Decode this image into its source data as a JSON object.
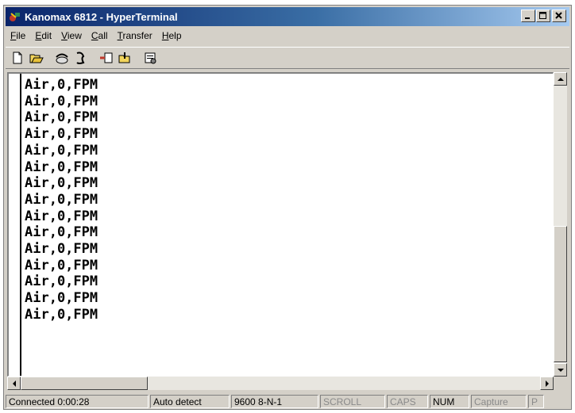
{
  "window": {
    "title": "Kanomax 6812 - HyperTerminal"
  },
  "menu": [
    {
      "key": "F",
      "rest": "ile"
    },
    {
      "key": "E",
      "rest": "dit"
    },
    {
      "key": "V",
      "rest": "iew"
    },
    {
      "key": "C",
      "rest": "all"
    },
    {
      "key": "T",
      "rest": "ransfer"
    },
    {
      "key": "H",
      "rest": "elp"
    }
  ],
  "terminal": {
    "lines": [
      "Air,0,FPM",
      "Air,0,FPM",
      "Air,0,FPM",
      "Air,0,FPM",
      "Air,0,FPM",
      "Air,0,FPM",
      "Air,0,FPM",
      "Air,0,FPM",
      "Air,0,FPM",
      "Air,0,FPM",
      "Air,0,FPM",
      "Air,0,FPM",
      "Air,0,FPM",
      "Air,0,FPM",
      "Air,0,FPM"
    ]
  },
  "status": {
    "connected": "Connected 0:00:28",
    "detect": "Auto detect",
    "settings": "9600 8-N-1",
    "scroll": "SCROLL",
    "caps": "CAPS",
    "num": "NUM",
    "capture": "Capture",
    "print": "P"
  },
  "colors": {
    "title_start": "#0a246a",
    "title_end": "#a6caf0",
    "chrome": "#d4d0c8"
  }
}
